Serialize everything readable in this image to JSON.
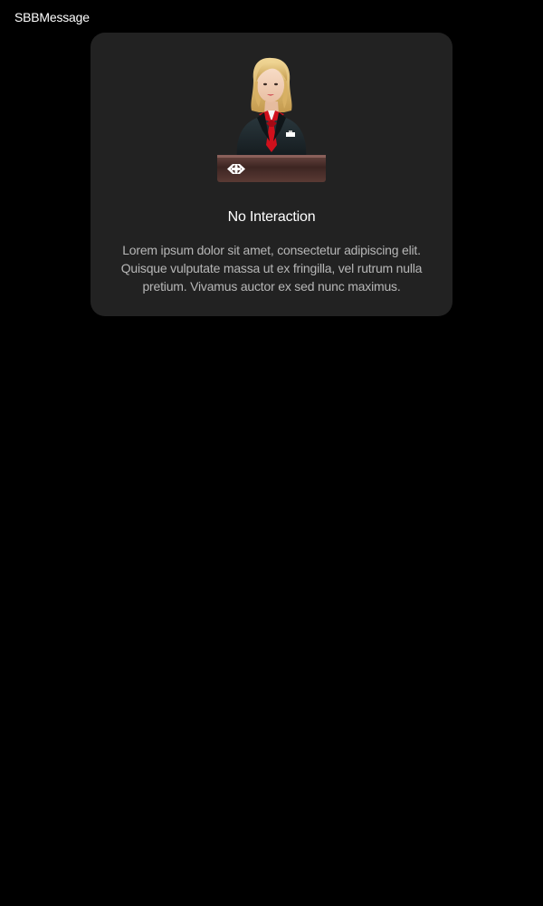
{
  "page": {
    "title": "SBBMessage"
  },
  "message": {
    "illustration": "sbb-staff-at-counter-illustration",
    "title": "No Interaction",
    "body": "Lorem ipsum dolor sit amet, consectetur adipiscing elit. Quisque vulputate massa ut ex fringilla, vel rutrum nulla pretium. Vivamus auctor ex sed nunc maximus."
  },
  "colors": {
    "background": "#000000",
    "card": "#222222",
    "title_text": "#ffffff",
    "body_text": "#b7b7b7",
    "accent_red": "#d0101c"
  }
}
